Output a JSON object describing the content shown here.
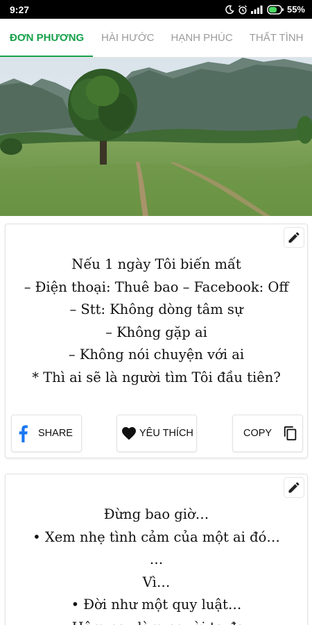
{
  "status_bar": {
    "time": "9:27",
    "battery": "55%"
  },
  "tabs": [
    {
      "label": "ĐƠN PHƯƠNG",
      "active": true
    },
    {
      "label": "HÀI HƯỚC",
      "active": false
    },
    {
      "label": "HẠNH PHÚC",
      "active": false
    },
    {
      "label": "THẤT TÌNH",
      "active": false
    }
  ],
  "colors": {
    "accent": "#17a04a",
    "facebook": "#1877f2"
  },
  "cards": [
    {
      "lines": [
        "Nếu 1 ngày Tôi biến mất",
        "– Điện thoại: Thuê bao – Facebook: Off",
        "– Stt: Không dòng tâm sự",
        "– Không gặp ai",
        "– Không nói chuyện với ai",
        "* Thì ai sẽ là người tìm Tôi đầu tiên?"
      ],
      "actions": {
        "share": "SHARE",
        "like": "YÊU THÍCH",
        "copy": "COPY"
      }
    },
    {
      "lines": [
        "Đừng bao giờ…",
        "• Xem nhẹ tình cảm của một ai đó…",
        "…",
        "Vì…",
        "• Đời như một quy luật…",
        "• Hôm nay làm người ta đau"
      ]
    }
  ],
  "icons": {
    "edit": "pencil-icon",
    "share": "facebook-icon",
    "like": "heart-icon",
    "copy": "copy-icon"
  }
}
